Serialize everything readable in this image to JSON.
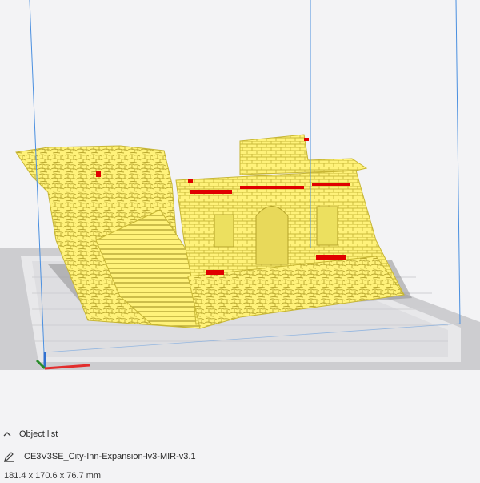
{
  "objects_panel": {
    "toggle_label": "Object list",
    "object_name": "CE3V3SE_City-Inn-Expansion-lv3-MIR-v3.1",
    "dimensions": "181.4 x 170.6 x 76.7 mm"
  },
  "colors": {
    "model_fill": "#fff27a",
    "model_overhang": "#e00000",
    "build_plate": "#c9c9cc",
    "plate_inner": "#e7e7e9",
    "axis_x": "#e22d2d",
    "axis_y": "#2a8c2a",
    "axis_z": "#3070d0",
    "build_volume_line": "#4a8fe0"
  },
  "icons": {
    "toggle": "chevron-up-icon",
    "edit": "pencil-icon"
  }
}
